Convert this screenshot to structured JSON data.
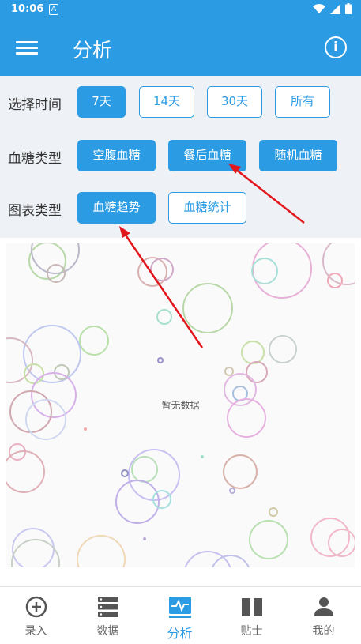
{
  "status": {
    "time": "10:06"
  },
  "appbar": {
    "title": "分析"
  },
  "filters": {
    "time": {
      "label": "选择时间",
      "options": [
        "7天",
        "14天",
        "30天",
        "所有"
      ]
    },
    "glucose_type": {
      "label": "血糖类型",
      "options": [
        "空腹血糖",
        "餐后血糖",
        "随机血糖"
      ]
    },
    "chart_type": {
      "label": "图表类型",
      "options": [
        "血糖趋势",
        "血糖统计"
      ]
    }
  },
  "chart": {
    "empty_text": "暂无数据"
  },
  "bottom_nav": {
    "items": [
      "录入",
      "数据",
      "分析",
      "贴士",
      "我的"
    ]
  },
  "colors": {
    "primary": "#2b9be3",
    "annotation_arrow": "#e3161c"
  }
}
